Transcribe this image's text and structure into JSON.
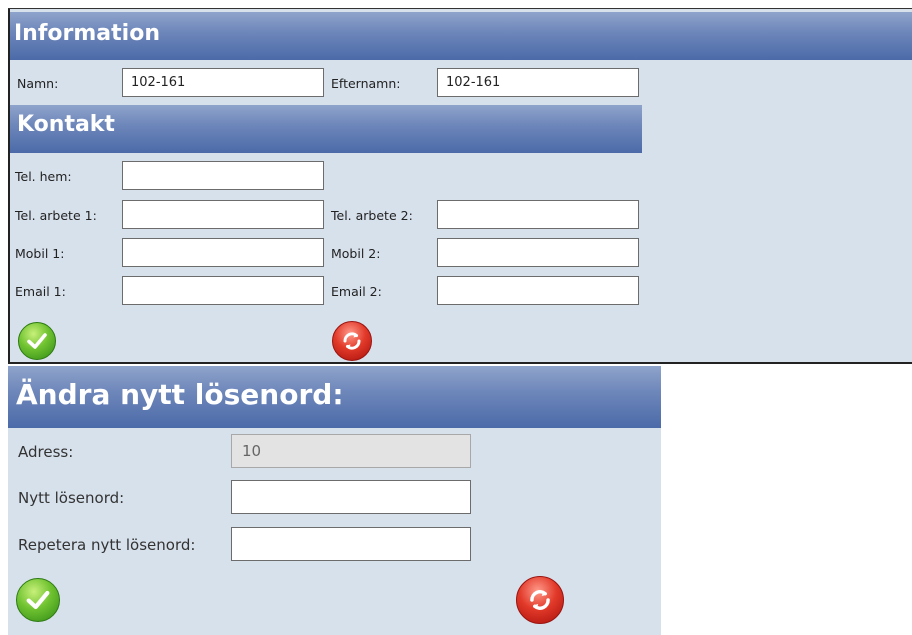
{
  "info": {
    "title": "Information",
    "namn_label": "Namn:",
    "namn_value": "102-161",
    "efternamn_label": "Efternamn:",
    "efternamn_value": "102-161"
  },
  "kontakt": {
    "title": "Kontakt",
    "tel_hem_label": "Tel. hem:",
    "tel_arbete1_label": "Tel. arbete 1:",
    "tel_arbete2_label": "Tel. arbete 2:",
    "mobil1_label": "Mobil 1:",
    "mobil2_label": "Mobil 2:",
    "email1_label": "Email 1:",
    "email2_label": "Email 2:"
  },
  "icons": {
    "confirm": "checkmark-icon",
    "cancel": "cancel-icon"
  },
  "password": {
    "title": "Ändra nytt lösenord:",
    "adress_label": "Adress:",
    "adress_value": "10",
    "nytt_label": "Nytt lösenord:",
    "repetera_label": "Repetera nytt lösenord:"
  },
  "colors": {
    "header_top": "#8fa4cb",
    "header_bottom": "#4b6aa8",
    "panel_bg": "#d7e1ec",
    "ok_green": "#4caa22",
    "cancel_red": "#d8261c"
  }
}
